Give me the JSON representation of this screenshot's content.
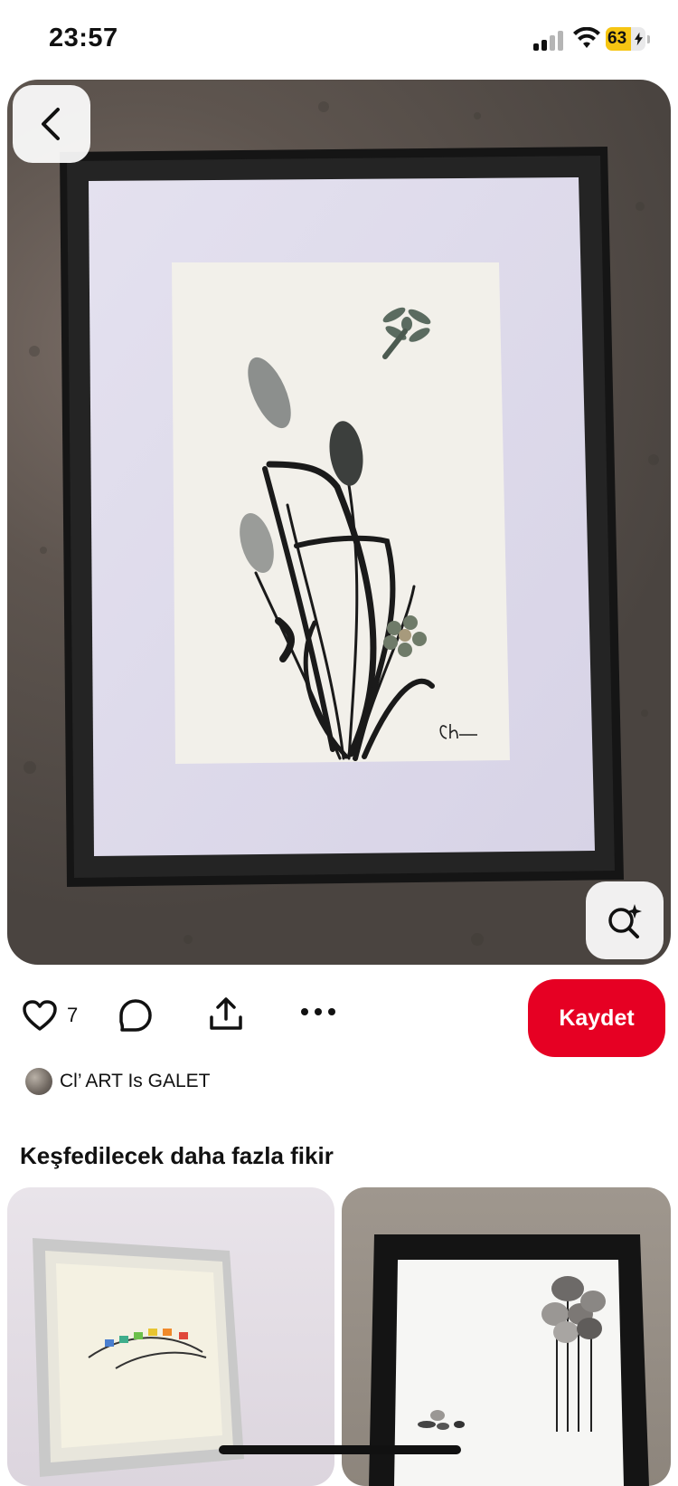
{
  "status_bar": {
    "time": "23:57",
    "battery": "63",
    "battery_level": 0.63
  },
  "pin": {
    "like_count": "7",
    "save_label": "Kaydet"
  },
  "author": {
    "name": "Cl’ ART Is GALET"
  },
  "more_ideas": {
    "title": "Keşfedilecek daha fazla fikir"
  },
  "icons": {
    "back": "chevron-left-icon",
    "visual_search": "visual-search-icon",
    "like": "heart-icon",
    "comment": "comment-icon",
    "share": "share-icon",
    "more": "more-icon"
  },
  "colors": {
    "accent": "#e60023",
    "battery": "#f6c512"
  }
}
